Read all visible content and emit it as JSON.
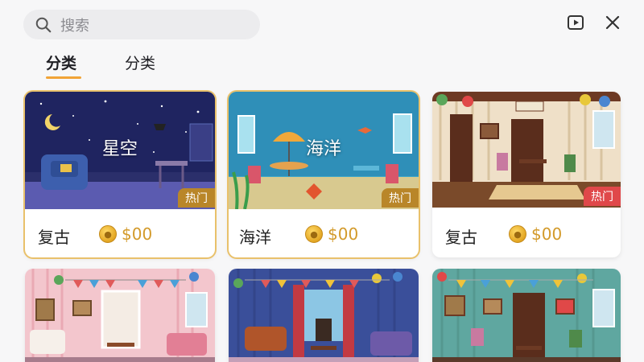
{
  "search": {
    "placeholder": "搜索",
    "icon": "search-icon"
  },
  "top_actions": {
    "play_icon": "play-icon",
    "close_icon": "close-icon"
  },
  "tabs": [
    {
      "label": "分类",
      "active": true
    },
    {
      "label": "分类",
      "active": false
    }
  ],
  "accent_color": "#f1a437",
  "cards": [
    {
      "overlay": "星空",
      "name": "复古",
      "price": "$00",
      "badge": "热门",
      "badge_color": "#b98629"
    },
    {
      "overlay": "海洋",
      "name": "海洋",
      "price": "$00",
      "badge": "热门",
      "badge_color": "#b98629"
    },
    {
      "overlay": "",
      "name": "复古",
      "price": "$00",
      "badge": "热门",
      "badge_color": "#e0484a"
    },
    {
      "overlay": "",
      "name": "",
      "price": "",
      "badge": ""
    },
    {
      "overlay": "",
      "name": "",
      "price": "",
      "badge": ""
    },
    {
      "overlay": "",
      "name": "",
      "price": "",
      "badge": ""
    }
  ]
}
